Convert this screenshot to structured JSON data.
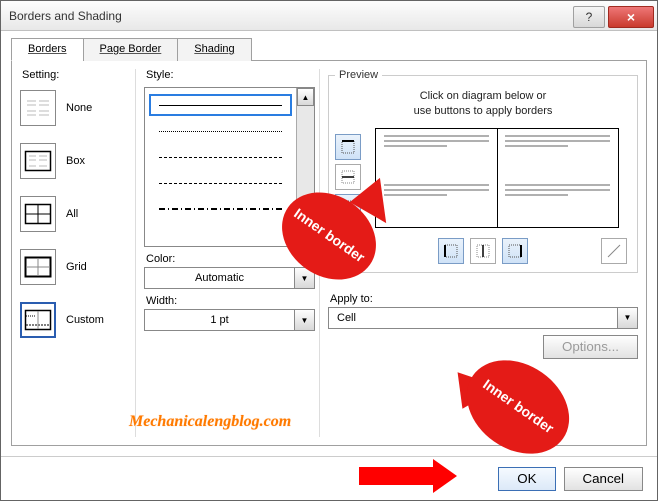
{
  "title": "Borders and Shading",
  "tabs": {
    "borders": "Borders",
    "pageBorder": "Page Border",
    "shading": "Shading"
  },
  "setting_label": "Setting:",
  "settings": {
    "none": "None",
    "box": "Box",
    "all": "All",
    "grid": "Grid",
    "custom": "Custom"
  },
  "style_label": "Style:",
  "color_label": "Color:",
  "color_value": "Automatic",
  "width_label": "Width:",
  "width_value": "1 pt",
  "preview_legend": "Preview",
  "preview_hint_l1": "Click on diagram below or",
  "preview_hint_l2": "use buttons to apply borders",
  "applyto_label": "Apply to:",
  "applyto_value": "Cell",
  "options_label": "Options...",
  "ok_label": "OK",
  "cancel_label": "Cancel",
  "annotations": {
    "bubble1": "Inner border",
    "bubble2": "Inner border",
    "watermark": "Mechanicalengblog.com"
  }
}
